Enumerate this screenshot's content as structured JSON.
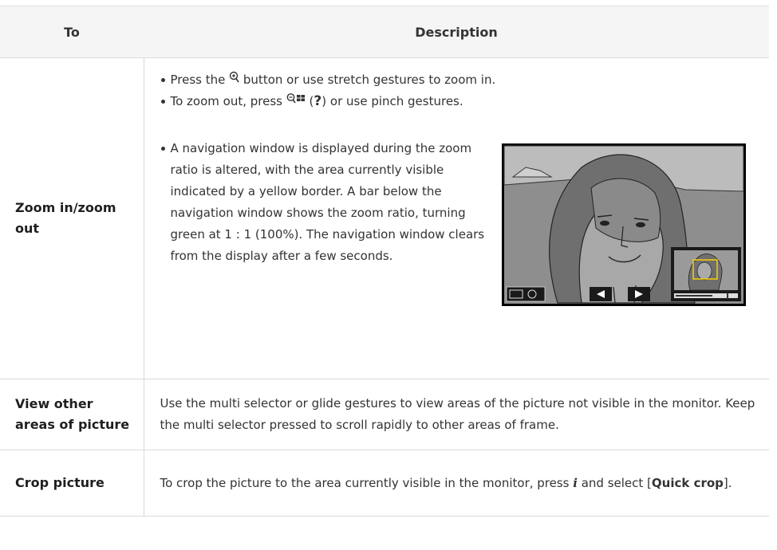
{
  "header": {
    "col_to": "To",
    "col_description": "Description"
  },
  "rows": [
    {
      "to": "Zoom in/zoom out",
      "bullets": {
        "b1_pre": "Press the ",
        "b1_icon": "zoom-in-icon",
        "b1_post": " button or use stretch gestures to zoom in.",
        "b2_pre": "To zoom out, press ",
        "b2_icon": "zoom-out-thumbnail-icon",
        "b2_mid": " (",
        "b2_key": "?",
        "b2_post": ") or use pinch gestures.",
        "b3": "A navigation window is displayed during the zoom ratio is altered, with the area currently visible indicated by a yellow border. A bar below the navigation window shows the zoom ratio, turning green at 1 : 1 (100%). The navigation window clears from the display after a few seconds."
      }
    },
    {
      "to": "View other areas of picture",
      "description": "Use the multi selector or glide gestures to view areas of the picture not visible in the monitor. Keep the multi selector pressed to scroll rapidly to other areas of frame."
    },
    {
      "to": "Crop picture",
      "desc_pre": "To crop the picture to the area currently visible in the monitor, press ",
      "desc_key": "i",
      "desc_mid": " and select [",
      "desc_bold": "Quick crop",
      "desc_post": "]."
    }
  ],
  "colors": {
    "header_bg": "#f5f5f5",
    "border": "#d9d9d9",
    "nav_border": "#ffd400"
  }
}
